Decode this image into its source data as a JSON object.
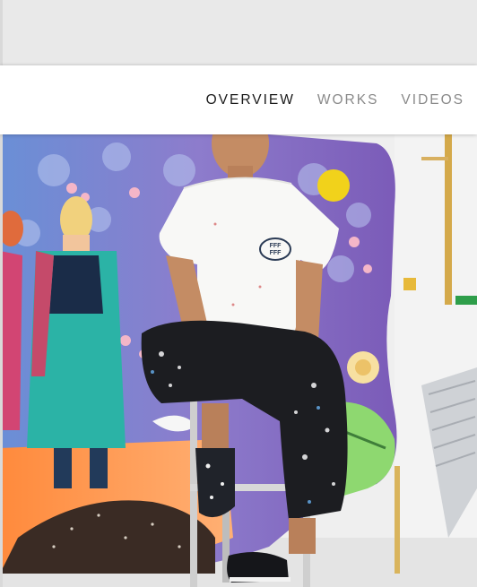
{
  "nav": {
    "items": [
      {
        "label": "OVERVIEW",
        "active": true
      },
      {
        "label": "WORKS",
        "active": false
      },
      {
        "label": "VIDEOS",
        "active": false
      }
    ]
  },
  "hero_photo": {
    "subject": "artist seated on a stool in front of a large colourful painting",
    "shirt_logo_text": "FFF FFF"
  },
  "colors": {
    "nav_active": "#1a1a1a",
    "nav_inactive": "#8a8a8a",
    "nav_bg": "#ffffff"
  }
}
